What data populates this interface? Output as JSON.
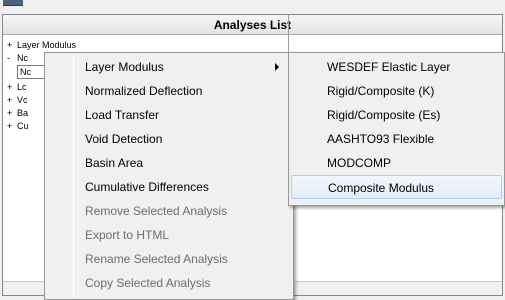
{
  "panel": {
    "title": "Analyses List"
  },
  "tree": {
    "rows": [
      {
        "expander": "+",
        "label": "Layer Modulus"
      },
      {
        "expander": "-",
        "label": "Nc"
      },
      {
        "expander": "",
        "label": "Nc"
      },
      {
        "expander": "+",
        "label": "Lc"
      },
      {
        "expander": "+",
        "label": "Vc"
      },
      {
        "expander": "+",
        "label": "Ba"
      },
      {
        "expander": "+",
        "label": "Cu"
      }
    ]
  },
  "context_menu": {
    "items": [
      {
        "label": "Layer Modulus",
        "enabled": true,
        "submenu": true
      },
      {
        "label": "Normalized Deflection",
        "enabled": true
      },
      {
        "label": "Load Transfer",
        "enabled": true
      },
      {
        "label": "Void Detection",
        "enabled": true
      },
      {
        "label": "Basin Area",
        "enabled": true
      },
      {
        "label": "Cumulative Differences",
        "enabled": true
      },
      {
        "label": "Remove Selected Analysis",
        "enabled": false
      },
      {
        "label": "Export to HTML",
        "enabled": false
      },
      {
        "label": "Rename Selected Analysis",
        "enabled": false
      },
      {
        "label": "Copy Selected Analysis",
        "enabled": false
      }
    ]
  },
  "submenu": {
    "items": [
      {
        "label": "WESDEF Elastic Layer",
        "highlighted": false
      },
      {
        "label": "Rigid/Composite (K)",
        "highlighted": false
      },
      {
        "label": "Rigid/Composite (Es)",
        "highlighted": false
      },
      {
        "label": "AASHTO93 Flexible",
        "highlighted": false
      },
      {
        "label": "MODCOMP",
        "highlighted": false
      },
      {
        "label": "Composite Modulus",
        "highlighted": true
      }
    ]
  },
  "colors": {
    "highlight_border": "#aecff7",
    "highlight_fill": "#e1ecf9",
    "disabled_text": "#6d6d6d",
    "menu_bg": "#f0f0f0"
  }
}
